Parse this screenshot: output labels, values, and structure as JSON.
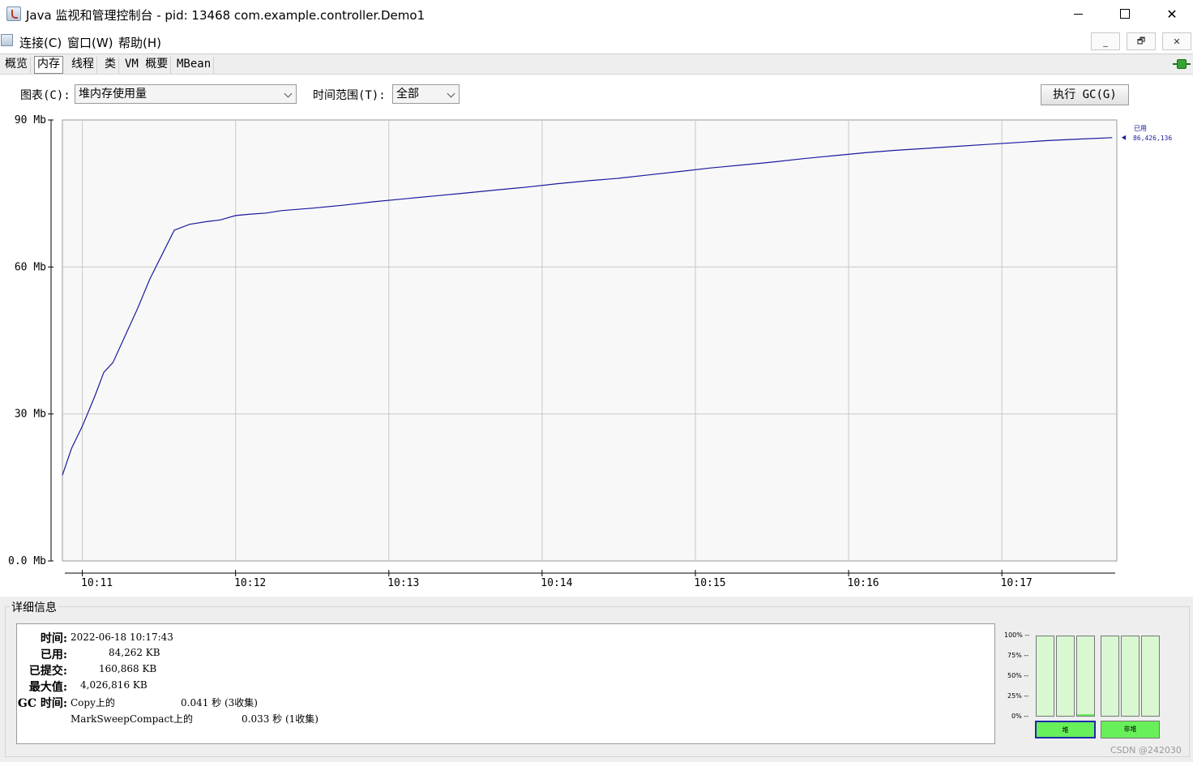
{
  "window": {
    "title": "Java 监视和管理控制台 - pid: 13468 com.example.controller.Demo1",
    "minimize": "–",
    "maximize": "□",
    "close": "✕"
  },
  "menu": {
    "connect": "连接(C)",
    "window": "窗口(W)",
    "help": "帮助(H)",
    "inner_minimize": "_",
    "inner_restore": "🗗",
    "inner_close": "✕"
  },
  "tabs": [
    "概览",
    "内存",
    "线程",
    "类",
    "VM 概要",
    "MBean"
  ],
  "active_tab": "内存",
  "controls": {
    "chart_label": "图表(C):",
    "chart_value": "堆内存使用量",
    "range_label": "时间范围(T):",
    "range_value": "全部",
    "gc_button": "执行 GC(G)"
  },
  "chart_data": {
    "type": "line",
    "title": "",
    "xlabel": "",
    "ylabel": "",
    "y_tick_labels": [
      "90 Mb",
      "60 Mb",
      "30 Mb",
      "0.0 Mb"
    ],
    "y_ticks": [
      90,
      60,
      30,
      0
    ],
    "ylim": [
      0,
      90
    ],
    "x_tick_labels": [
      "10:11",
      "10:12",
      "10:13",
      "10:14",
      "10:15",
      "10:16",
      "10:17"
    ],
    "x_ticks_min": [
      0,
      1,
      2,
      3,
      4,
      5,
      6
    ],
    "xlim_min": [
      -0.13,
      6.75
    ],
    "grid": true,
    "line_color": "#1a1a9e",
    "series": [
      {
        "name": "已用",
        "x_min": [
          -0.13,
          -0.07,
          0.0,
          0.08,
          0.14,
          0.2,
          0.28,
          0.36,
          0.44,
          0.52,
          0.6,
          0.7,
          0.82,
          0.9,
          1.0,
          1.1,
          1.2,
          1.3,
          1.5,
          1.7,
          1.9,
          2.1,
          2.3,
          2.5,
          2.7,
          2.9,
          3.1,
          3.3,
          3.5,
          3.7,
          3.9,
          4.1,
          4.3,
          4.5,
          4.7,
          4.9,
          5.1,
          5.3,
          5.5,
          5.7,
          5.9,
          6.1,
          6.3,
          6.5,
          6.72
        ],
        "values": [
          17.5,
          23,
          27.5,
          33.5,
          38.5,
          40.5,
          46,
          51.5,
          57.5,
          62.5,
          67.5,
          68.7,
          69.3,
          69.6,
          70.5,
          70.8,
          71.0,
          71.5,
          72.0,
          72.6,
          73.3,
          73.9,
          74.5,
          75.1,
          75.7,
          76.3,
          77.0,
          77.6,
          78.1,
          78.8,
          79.5,
          80.2,
          80.8,
          81.4,
          82.1,
          82.7,
          83.3,
          83.8,
          84.2,
          84.6,
          85.0,
          85.4,
          85.8,
          86.1,
          86.4
        ]
      }
    ],
    "legend_label": "已用",
    "legend_value": "86,426,136"
  },
  "details": {
    "legend": "详细信息",
    "time_label": "时间:",
    "time_value": "2022-06-18 10:17:43",
    "used_label": "已用:",
    "used_value": "84,262 KB",
    "committed_label": "已提交:",
    "committed_value": "160,868 KB",
    "max_label": "最大值:",
    "max_value": "4,026,816 KB",
    "gc_label": "GC 时间:",
    "gc1_name": "Copy上的",
    "gc1_time": "0.041 秒 (3收集)",
    "gc2_name": "MarkSweepCompact上的",
    "gc2_time": "0.033 秒 (1收集)"
  },
  "pools": {
    "pct_labels": [
      "100% --",
      "75% --",
      "50% --",
      "25% --",
      "0% --"
    ],
    "heap_label": "堆",
    "nonheap_label": "非堆",
    "heap_levels": [
      0.0,
      0.0,
      0.02
    ],
    "nonheap_levels": [
      0.0,
      0.0,
      0.0
    ],
    "fill_color": "#68f05a"
  },
  "watermark": "CSDN @242030"
}
